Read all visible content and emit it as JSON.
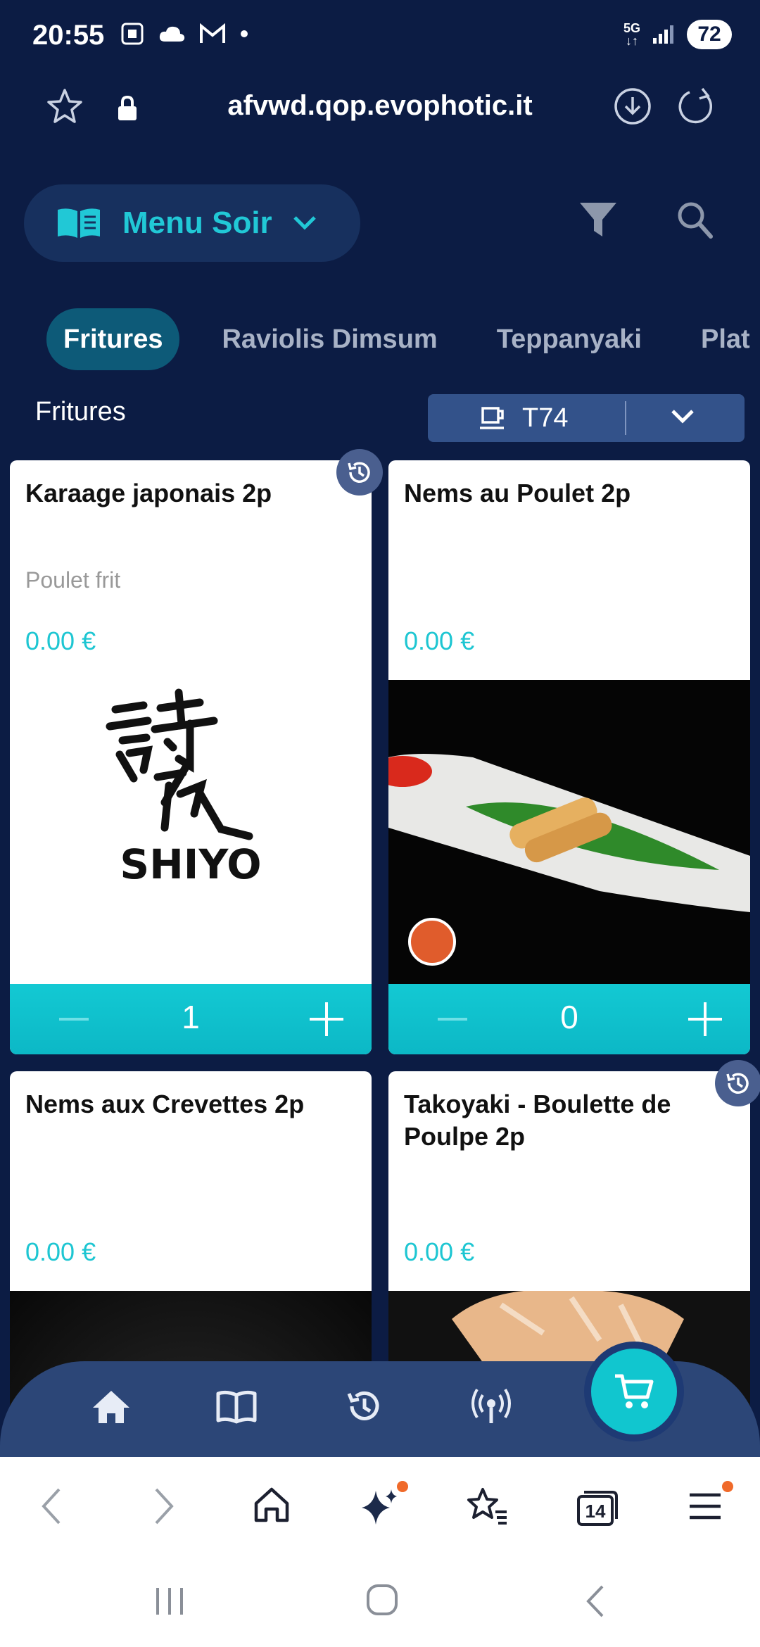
{
  "status_bar": {
    "time": "20:55",
    "network": "5G",
    "battery": "72"
  },
  "browser": {
    "url": "afvwd.qop.evophotic.it",
    "tab_count": "14"
  },
  "header": {
    "menu_label": "Menu Soir"
  },
  "tabs": [
    {
      "label": "Fritures",
      "active": true
    },
    {
      "label": "Raviolis Dimsum",
      "active": false
    },
    {
      "label": "Teppanyaki",
      "active": false
    },
    {
      "label": "Plat",
      "active": false
    }
  ],
  "section": {
    "title": "Fritures",
    "table_label": "T74"
  },
  "products": [
    {
      "name": "Karaage japonais 2p",
      "description": "Poulet frit",
      "price": "0.00 €",
      "quantity": "1",
      "image": "shiyo-logo",
      "logo_text": "SHIYO"
    },
    {
      "name": "Nems au Poulet 2p",
      "description": "",
      "price": "0.00 €",
      "quantity": "0",
      "image": "spring-rolls-photo"
    },
    {
      "name": "Nems aux Crevettes 2p",
      "description": "",
      "price": "0.00 €",
      "image": "dark-photo"
    },
    {
      "name": "Takoyaki - Boulette de Poulpe 2p",
      "description": "",
      "price": "0.00 €",
      "image": "takoyaki-photo"
    }
  ],
  "icons": {
    "menu": "book-icon",
    "filter": "filter-icon",
    "search": "search-icon",
    "cart": "cart-icon"
  },
  "colors": {
    "background": "#0c1c44",
    "accent": "#1ec6d2",
    "tab_active": "#0d5a78",
    "nav_bar": "#2c4677",
    "notification": "#f06a2a"
  }
}
